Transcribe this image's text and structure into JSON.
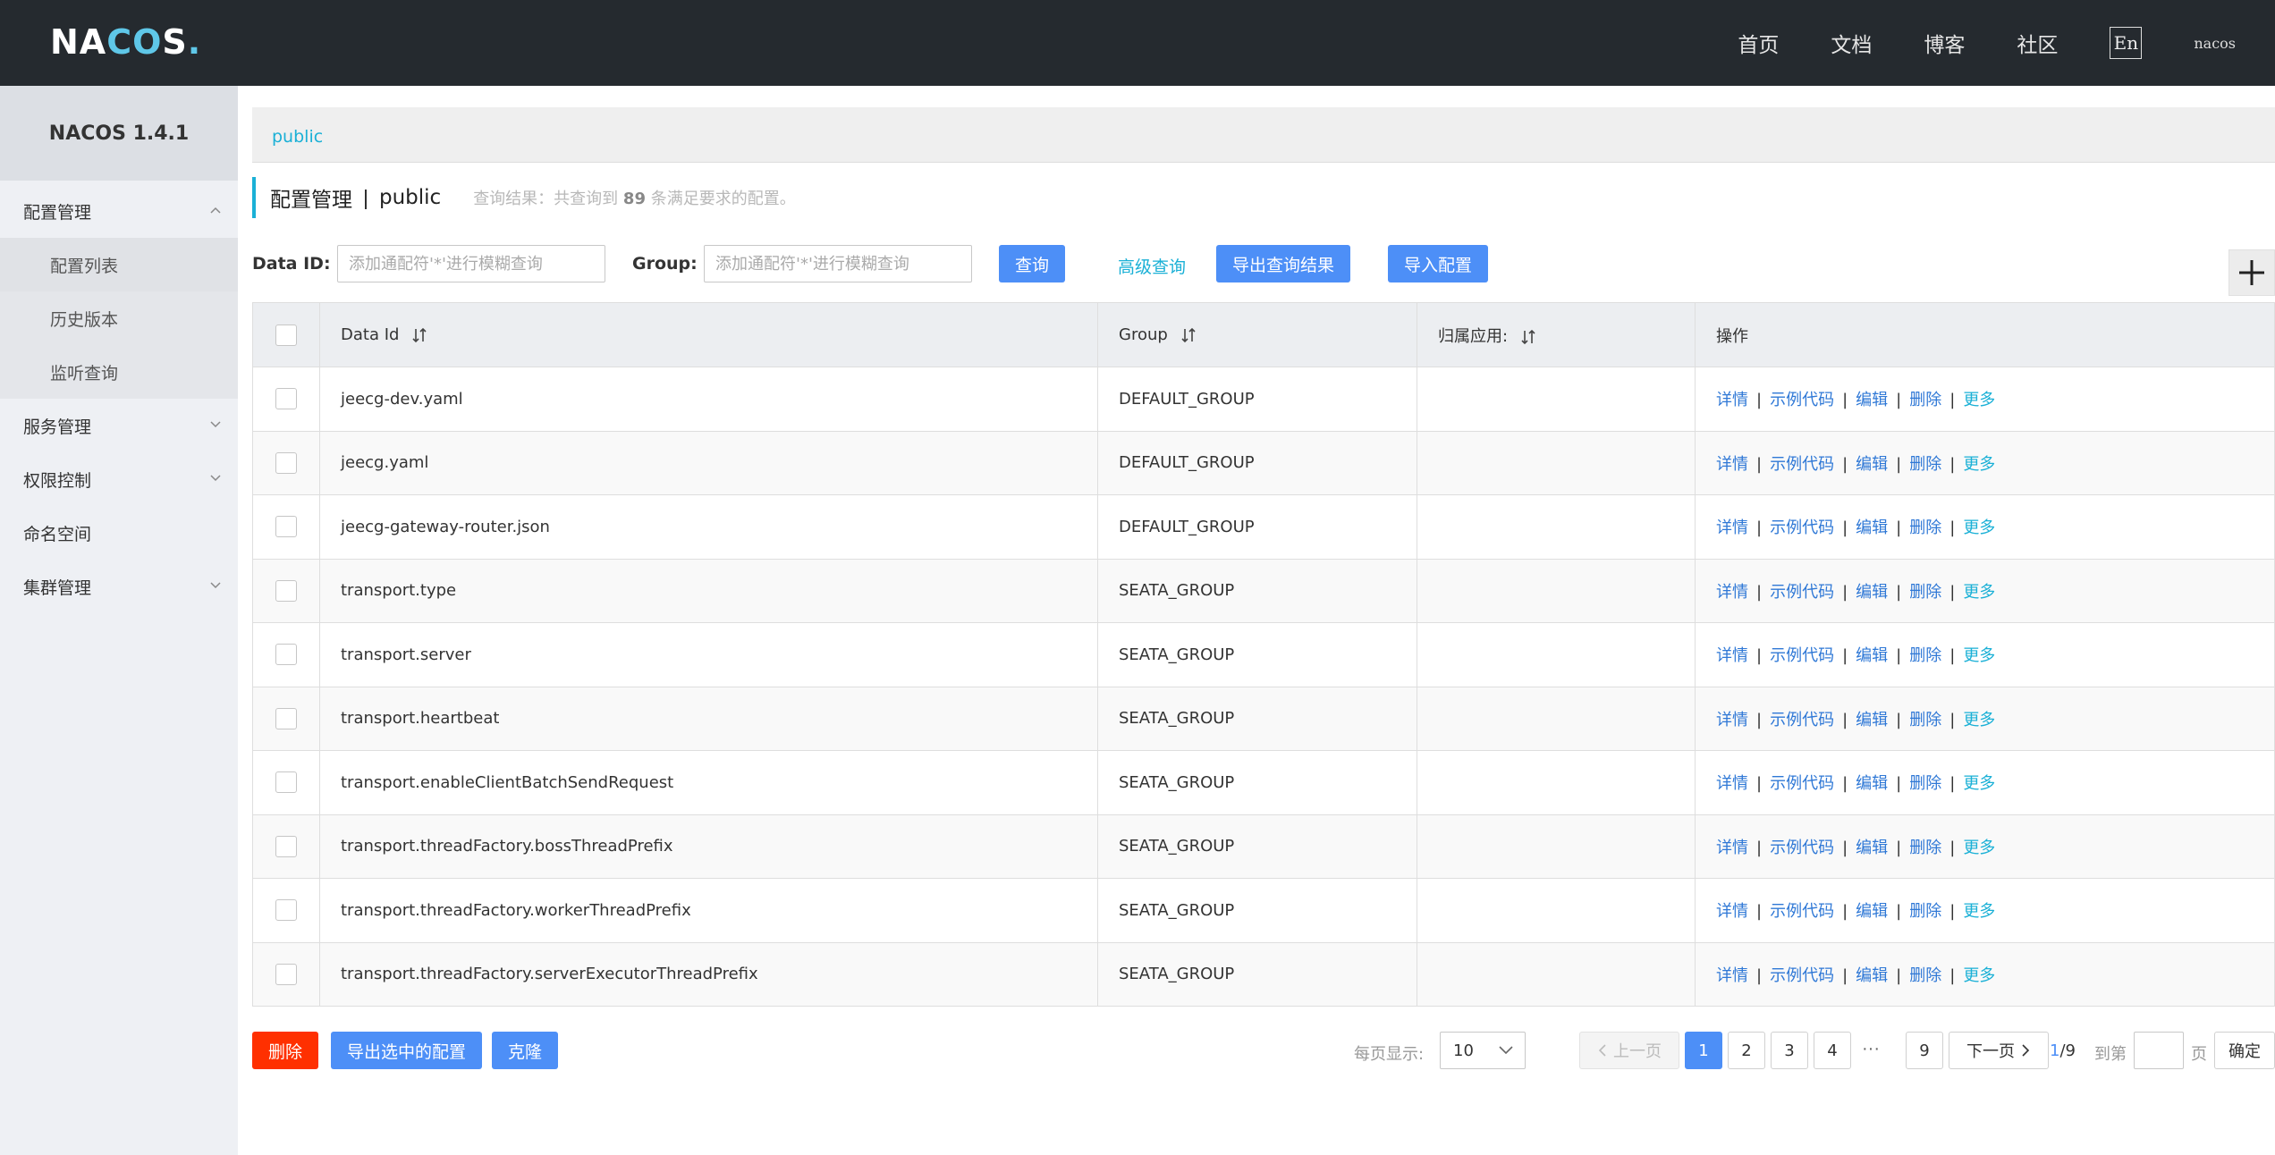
{
  "brand": {
    "logo_n": "NA",
    "logo_co": "CO",
    "logo_s": "S",
    "logo_dot": "."
  },
  "nav": {
    "home": "首页",
    "docs": "文档",
    "blog": "博客",
    "community": "社区",
    "lang": "En",
    "user": "nacos"
  },
  "sidebar": {
    "version": "NACOS 1.4.1",
    "config_mgmt": "配置管理",
    "config_list": "配置列表",
    "history": "历史版本",
    "listener": "监听查询",
    "service_mgmt": "服务管理",
    "auth": "权限控制",
    "namespace": "命名空间",
    "cluster": "集群管理"
  },
  "breadcrumb": {
    "namespace": "public"
  },
  "page": {
    "title": "配置管理",
    "separator": "|",
    "namespace": "public",
    "summary_prefix": "查询结果：共查询到",
    "summary_count": "89",
    "summary_suffix": "条满足要求的配置。"
  },
  "filters": {
    "dataid_label": "Data ID:",
    "dataid_placeholder": "添加通配符'*'进行模糊查询",
    "group_label": "Group:",
    "group_placeholder": "添加通配符'*'进行模糊查询",
    "query": "查询",
    "advanced": "高级查询",
    "export_results": "导出查询结果",
    "import": "导入配置"
  },
  "table": {
    "headers": {
      "data_id": "Data Id",
      "group": "Group",
      "app": "归属应用:",
      "ops": "操作"
    },
    "rows": [
      {
        "data_id": "jeecg-dev.yaml",
        "group": "DEFAULT_GROUP",
        "app": ""
      },
      {
        "data_id": "jeecg.yaml",
        "group": "DEFAULT_GROUP",
        "app": ""
      },
      {
        "data_id": "jeecg-gateway-router.json",
        "group": "DEFAULT_GROUP",
        "app": ""
      },
      {
        "data_id": "transport.type",
        "group": "SEATA_GROUP",
        "app": ""
      },
      {
        "data_id": "transport.server",
        "group": "SEATA_GROUP",
        "app": ""
      },
      {
        "data_id": "transport.heartbeat",
        "group": "SEATA_GROUP",
        "app": ""
      },
      {
        "data_id": "transport.enableClientBatchSendRequest",
        "group": "SEATA_GROUP",
        "app": ""
      },
      {
        "data_id": "transport.threadFactory.bossThreadPrefix",
        "group": "SEATA_GROUP",
        "app": ""
      },
      {
        "data_id": "transport.threadFactory.workerThreadPrefix",
        "group": "SEATA_GROUP",
        "app": ""
      },
      {
        "data_id": "transport.threadFactory.serverExecutorThreadPrefix",
        "group": "SEATA_GROUP",
        "app": ""
      }
    ],
    "ops": {
      "detail": "详情",
      "sample": "示例代码",
      "edit": "编辑",
      "delete": "删除",
      "more": "更多",
      "sep": "|"
    }
  },
  "footer": {
    "delete": "删除",
    "export_selected": "导出选中的配置",
    "clone": "克隆",
    "page_size_label": "每页显示:",
    "page_size": "10",
    "prev": "上一页",
    "pages": [
      "1",
      "2",
      "3",
      "4"
    ],
    "ellipsis": "···",
    "last_page": "9",
    "next": "下一页",
    "current": "1",
    "total": "/9",
    "goto_label": "到第",
    "page_unit": "页",
    "confirm": "确定"
  },
  "colors": {
    "topbar": "#252a2f",
    "accent": "#1ab0d6",
    "primary": "#4d8ff7",
    "danger": "#ff3000",
    "link": "#2f78d6"
  }
}
